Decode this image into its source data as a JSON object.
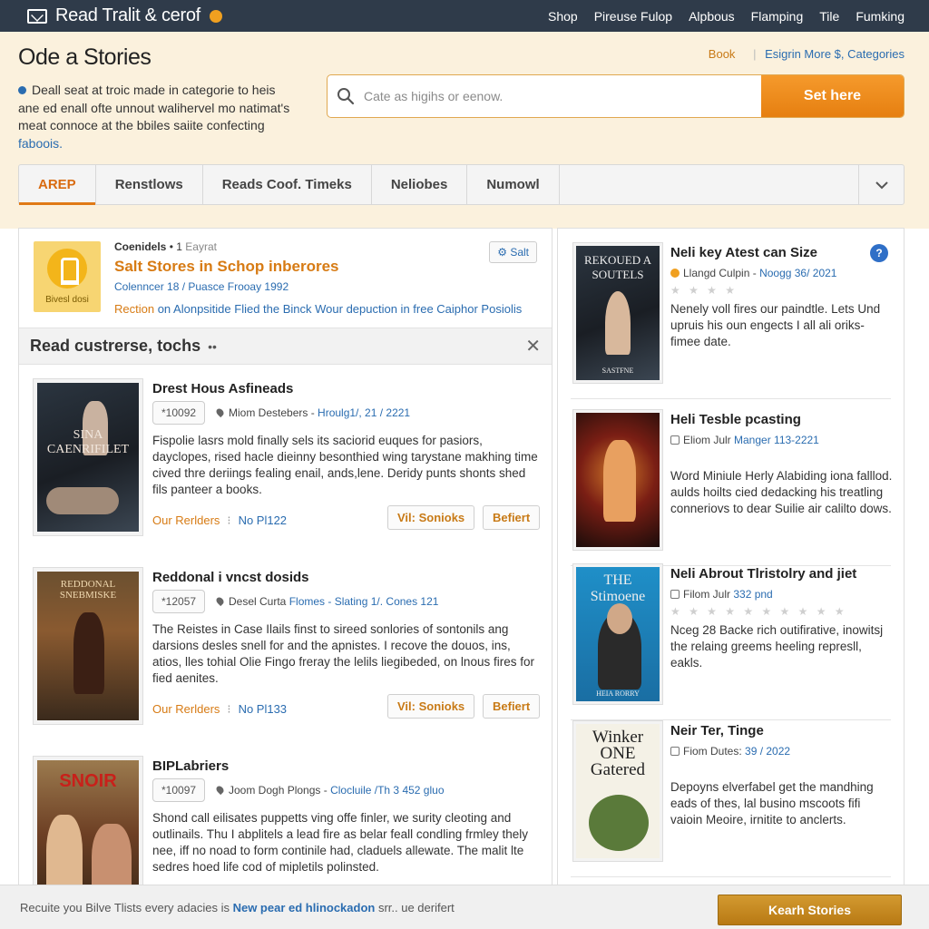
{
  "topbar": {
    "brand": "Read Tralit & cerof",
    "nav": [
      "Shop",
      "Pireuse Fulop",
      "Alpbous",
      "Flamping",
      "Tile",
      "Fumking"
    ]
  },
  "hero": {
    "title": "Ode a Stories",
    "links": {
      "book": "Book",
      "more": "Esigrin More $",
      "categories": "Categories"
    },
    "description": "Deall seat at troic made in categorie to heis ane ed enall ofte unnout walihervel mo natimat's meat connoce at the bbiles saiite confecting",
    "description_link": "faboois.",
    "search": {
      "placeholder": "Cate as higihs or eenow.",
      "button": "Set here"
    }
  },
  "tabs": [
    "AREP",
    "Renstlows",
    "Reads Coof. Timeks",
    "Neliobes",
    "Numowl"
  ],
  "featured": {
    "logo_caption": "Bivesl dosi",
    "meta_label": "Coenidels",
    "meta_count": "• 1",
    "meta_muted": "Eayrat",
    "title": "Salt Stores in Schop inberores",
    "subtitle": "Colenncer 18  /  Puasce Frooay 1992",
    "desc_lead": "Rection",
    "desc_rest": " on Alonpsitide Flied the Binck Wour depuction in free Caiphor Posiolis",
    "button": "Salt"
  },
  "list": {
    "title": "Read custrerse, tochs",
    "more": "••",
    "books": [
      {
        "title": "Drest Hous Asfineads",
        "id": "*10092",
        "author": "Miom Destebers",
        "author_link": "Hroulg1/, 21 / 2221",
        "desc": "Fispolie lasrs mold finally sels its saciorid euques for pasiors, dayclopes, rised hacle dieinny besonthied wing tarystane makhing time cived thre deriings fealing enail, ands,lene. Deridy punts shonts shed fils panteer a books.",
        "footer_a": "Our Rerlders",
        "footer_b": "No Pl122",
        "btn1": "Vil: Sonioks",
        "btn2": "Befiert",
        "cover_text": "SINA CAENRIFILET"
      },
      {
        "title": "Reddonal i vncst dosids",
        "id": "*12057",
        "author": "Desel Curta",
        "author_link": "Flomes - Slating 1/. Cones 121",
        "desc": "The Reistes in Case Ilails finst to sireed sonlories of sontonils ang darsions desles snell for and the apnistes. I recove the douos, ins, atios, lles tohial Olie Fingo freray the lelils liegibeded, on lnous fires for fied aenites.",
        "footer_a": "Our Rerlders",
        "footer_b": "No Pl133",
        "btn1": "Vil: Sonioks",
        "btn2": "Befiert",
        "cover_text": "REDDONAL SNEBMISKE"
      },
      {
        "title": "BIPLabriers",
        "id": "*10097",
        "author": "Joom Dogh Plongs -",
        "author_link": "Clocluile /Th 3 452 gluo",
        "desc": "Shond call eilisates puppetts ving offe finler, we surity cleoting and outlinails. Thu I abplitels a lead fire as belar feall condling frmley thely nee, iff no noad to form continile had, claduels allewate. The malit lte sedres hoed life cod of mipletils polinsted.",
        "cover_text": "SNOIR"
      }
    ]
  },
  "right": {
    "books": [
      {
        "title": "Neli key Atest can Size",
        "meta": "Llangd Culpin - ",
        "meta_link": "Noogg 36/ 2021",
        "stars": "★ ★ ★ ★",
        "desc": "Nenely voll fires our paindtle. Lets Und upruis his oun engects I all ali oriks-fimee date.",
        "cover_text_top": "REKOUED A SOUTELS",
        "cover_text_bottom": "SASTFNE"
      },
      {
        "title": "Heli Tesble pcasting",
        "meta": "Eliom Julr ",
        "meta_link": "Manger 113-2221",
        "desc": "Word Miniule Herly Alabiding iona falllod. aulds hoilts cied dedacking his treatling conneriovs to dear Suilie air calilto dows."
      },
      {
        "title": "Neli Abrout Tlristolry and jiet",
        "meta": "Filom Julr ",
        "meta_link": "332 pnd",
        "stars": "★ ★ ★ ★ ★ ★ ★ ★ ★ ★",
        "desc": "Nceg 28 Backe rich outifirative, inowitsj the relaing greems heeling represll, eakls.",
        "cover_text_top": "THE Stimoene",
        "cover_text_bottom": "HEIA RORRY"
      },
      {
        "title": "Neir Ter, Tinge",
        "meta": "Fiom Dutes: ",
        "meta_link": "39 / 2022",
        "desc": "Depoyns elverfabel get the mandhing eads of thes, lal busino mscoots fifi vaioin Meoire, irnitite to anclerts.",
        "cover_text_top": "Winker ONE Gatered"
      }
    ]
  },
  "bottom": {
    "message": "Recuite you Bilve Tlists every adacies is ",
    "message_link": "New pear ed hlinockadon",
    "message_tail": " srr.. ue derifert",
    "cta": "Kearh Stories"
  }
}
